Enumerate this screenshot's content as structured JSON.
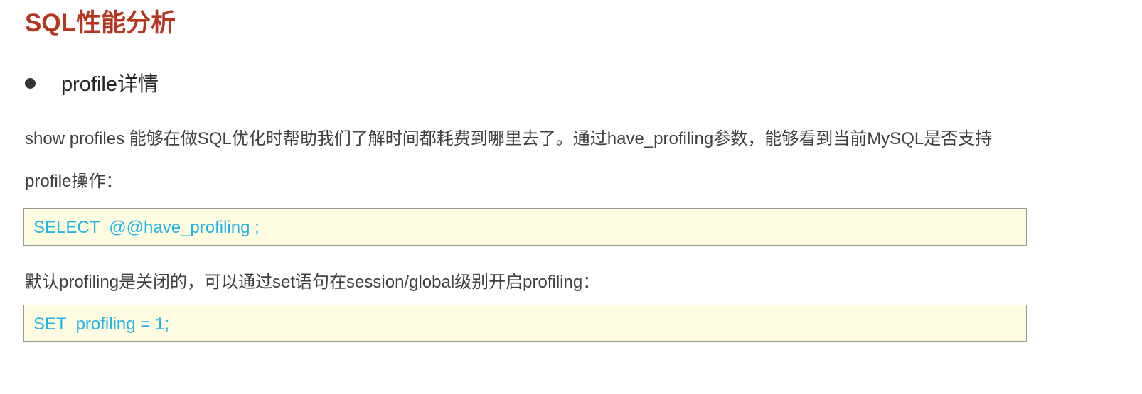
{
  "title": "SQL性能分析",
  "bullet": {
    "text": "profile详情"
  },
  "paragraphs": {
    "p1_line1": "show profiles 能够在做SQL优化时帮助我们了解时间都耗费到哪里去了。通过have_profiling参数，能够看到当前MySQL是否支持",
    "p1_line2": "profile操作：",
    "p2": "默认profiling是关闭的，可以通过set语句在session/global级别开启profiling："
  },
  "code": {
    "block1": "SELECT  @@have_profiling ;",
    "block2": "SET  profiling = 1;"
  },
  "colors": {
    "title": "#b5361f",
    "code_text": "#22b4e8",
    "code_bg": "#fefce0"
  }
}
